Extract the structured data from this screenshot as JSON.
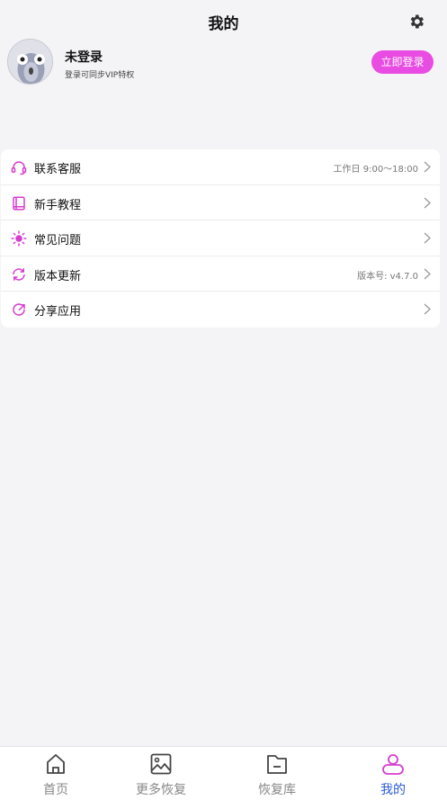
{
  "header": {
    "title": "我的",
    "settings_icon": "gear-icon"
  },
  "profile": {
    "avatar_icon": "owl-avatar-icon",
    "name": "未登录",
    "subtitle": "登录可同步VIP特权",
    "login_button": "立即登录"
  },
  "menu": {
    "items": [
      {
        "label": "联系客服",
        "icon": "headset-icon",
        "right_text": "工作日 9:00～18:00"
      },
      {
        "label": "新手教程",
        "icon": "book-icon",
        "right_text": ""
      },
      {
        "label": "常见问题",
        "icon": "bulb-icon",
        "right_text": ""
      },
      {
        "label": "版本更新",
        "icon": "refresh-icon",
        "right_text": "版本号: v4.7.0"
      },
      {
        "label": "分享应用",
        "icon": "share-icon",
        "right_text": ""
      }
    ]
  },
  "bottom_nav": {
    "items": [
      {
        "label": "首页",
        "icon": "home-icon"
      },
      {
        "label": "更多恢复",
        "icon": "image-icon"
      },
      {
        "label": "恢复库",
        "icon": "folder-icon"
      },
      {
        "label": "我的",
        "icon": "person-icon"
      }
    ],
    "active_index": 3
  },
  "colors": {
    "accent": "#e94ce2",
    "active_nav": "#2a5bd8",
    "background": "#f4f4f6"
  }
}
